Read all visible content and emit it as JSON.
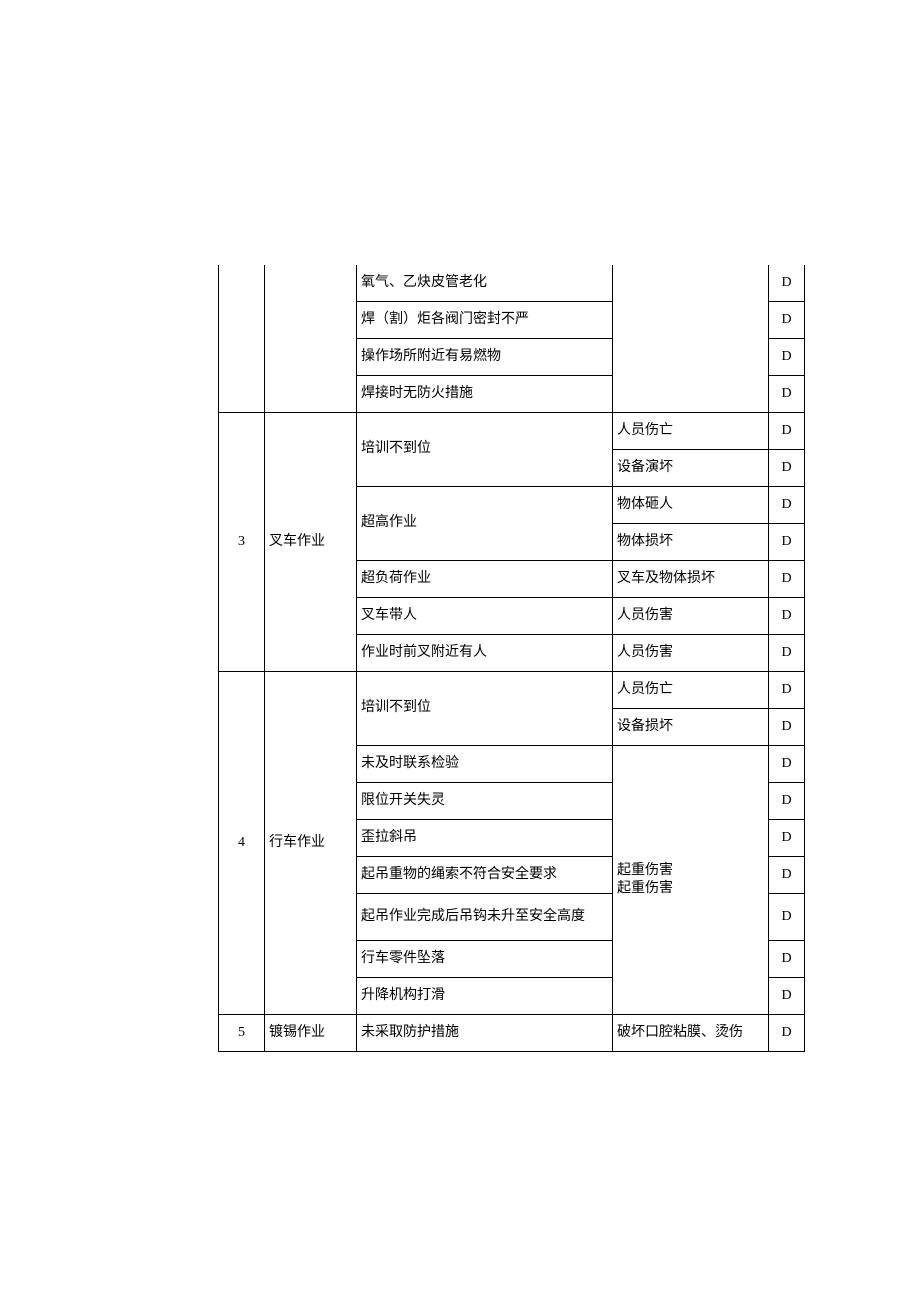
{
  "rows": {
    "r0c3": "氧气、乙炔皮管老化",
    "r0c5": "D",
    "r1c3": "焊（割）炬各阀门密封不严",
    "r1c5": "D",
    "r2c3": "操作场所附近有易燃物",
    "r2c5": "D",
    "r3c3": "焊接时无防火措施",
    "r3c5": "D",
    "g3num": "3",
    "g3name": "叉车作业",
    "r4c3": "培训不到位",
    "r4c4": "人员伤亡",
    "r4c5": "D",
    "r5c4": "设备演坏",
    "r5c5": "D",
    "r6c3": "超高作业",
    "r6c4": "物体砸人",
    "r6c5": "D",
    "r7c4": "物体损坏",
    "r7c5": "D",
    "r8c3": "超负荷作业",
    "r8c4": "叉车及物体损坏",
    "r8c5": "D",
    "r9c3": "叉车带人",
    "r9c4": "人员伤害",
    "r9c5": "D",
    "r10c3": "作业时前叉附近有人",
    "r10c4": "人员伤害",
    "r10c5": "D",
    "g4num": "4",
    "g4name": "行车作业",
    "r11c3": "培训不到位",
    "r11c4": "人员伤亡",
    "r11c5": "D",
    "r12c4": "设备损坏",
    "r12c5": "D",
    "r13c3": "未及时联系检验",
    "r13c5": "D",
    "r14c3": "限位开关失灵",
    "r14c5": "D",
    "r15c3": "歪拉斜吊",
    "r15c5": "D",
    "r16c3": "起吊重物的绳索不符合安全要求",
    "r16c4": "起重伤害\n起重伤害",
    "r16c5": "D",
    "r17c3": "起吊作业完成后吊钩未升至安全高度",
    "r17c5": "D",
    "r18c3": "行车零件坠落",
    "r18c5": "D",
    "r19c3": "升降机构打滑",
    "r19c5": "D",
    "g5num": "5",
    "g5name": "镀锡作业",
    "r20c3": "未采取防护措施",
    "r20c4": "破坏口腔粘膜、烫伤",
    "r20c5": "D"
  }
}
